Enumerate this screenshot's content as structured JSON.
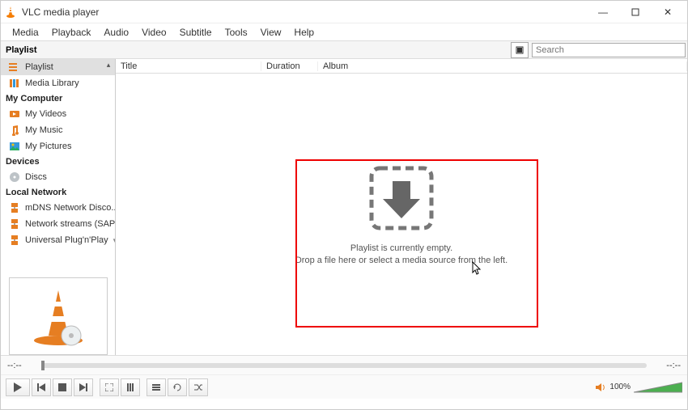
{
  "title": "VLC media player",
  "menu": [
    "Media",
    "Playback",
    "Audio",
    "Video",
    "Subtitle",
    "Tools",
    "View",
    "Help"
  ],
  "toolbar_label": "Playlist",
  "search_placeholder": "Search",
  "sidebar": {
    "items": [
      {
        "label": "Playlist",
        "icon": "playlist",
        "active": true
      },
      {
        "label": "Media Library",
        "icon": "library"
      }
    ],
    "computer_head": "My Computer",
    "computer": [
      {
        "label": "My Videos",
        "icon": "video"
      },
      {
        "label": "My Music",
        "icon": "music"
      },
      {
        "label": "My Pictures",
        "icon": "picture"
      }
    ],
    "devices_head": "Devices",
    "devices": [
      {
        "label": "Discs",
        "icon": "disc"
      }
    ],
    "network_head": "Local Network",
    "network": [
      {
        "label": "mDNS Network Disco...",
        "icon": "net"
      },
      {
        "label": "Network streams (SAP)",
        "icon": "net"
      },
      {
        "label": "Universal Plug'n'Play",
        "icon": "net"
      }
    ]
  },
  "columns": {
    "title": "Title",
    "duration": "Duration",
    "album": "Album"
  },
  "empty": {
    "line1": "Playlist is currently empty.",
    "line2": "Drop a file here or select a media source from the left."
  },
  "time_start": "--:--",
  "time_end": "--:--",
  "volume": "100%"
}
